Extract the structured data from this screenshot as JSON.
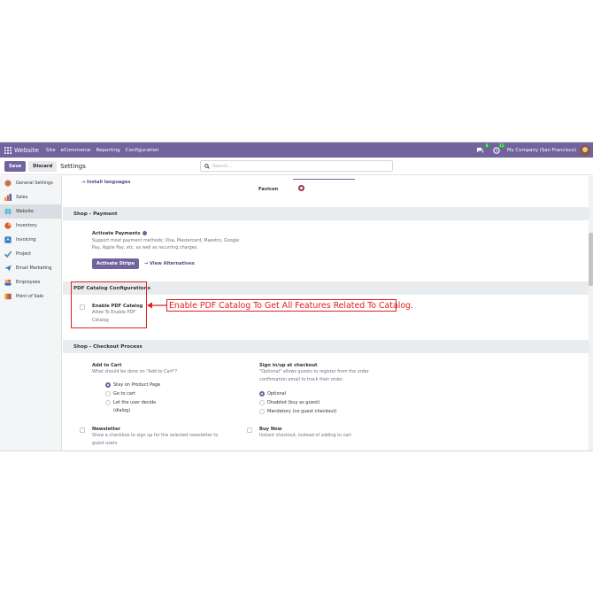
{
  "topbar": {
    "brand": "Website",
    "nav": [
      "Site",
      "eCommerce",
      "Reporting",
      "Configuration"
    ],
    "messages_count": "4",
    "activities_count": "11",
    "company": "My Company (San Francisco)",
    "accent": "#71639e"
  },
  "control": {
    "save_label": "Save",
    "discard_label": "Discard",
    "title": "Settings",
    "search_placeholder": "Search..."
  },
  "sidebar": {
    "items": [
      {
        "label": "General Settings",
        "icon": "general-settings-icon"
      },
      {
        "label": "Sales",
        "icon": "sales-icon"
      },
      {
        "label": "Website",
        "icon": "website-icon",
        "active": true
      },
      {
        "label": "Inventory",
        "icon": "inventory-icon"
      },
      {
        "label": "Invoicing",
        "icon": "invoicing-icon"
      },
      {
        "label": "Project",
        "icon": "project-icon"
      },
      {
        "label": "Email Marketing",
        "icon": "email-marketing-icon"
      },
      {
        "label": "Employees",
        "icon": "employees-icon"
      },
      {
        "label": "Point of Sale",
        "icon": "point-of-sale-icon"
      }
    ]
  },
  "main": {
    "install_languages": "Install languages",
    "favicon_label": "Favicon",
    "shop_payment": {
      "header": "Shop - Payment",
      "title": "Activate Payments",
      "desc": "Support most payment methods; Visa, Mastercard, Maestro, Google Pay, Apple Pay, etc. as well as recurring charges.",
      "stripe_button": "Activate Stripe",
      "alternatives_link": "View Alternatives"
    },
    "pdf_catalog": {
      "header": "PDF Catalog Configurations",
      "title": "Enable PDF Catalog",
      "desc_line1": "Allow To Enable PDF",
      "desc_line2": "Catalog",
      "callout": "Enable PDF Catalog To Get All Features Related To Catalog."
    },
    "checkout": {
      "header": "Shop - Checkout Process",
      "add_to_cart_title": "Add to Cart",
      "add_to_cart_desc": "What should be done on \"Add to Cart\"?",
      "add_to_cart_options": [
        "Stay on Product Page",
        "Go to cart",
        "Let the user decide",
        "(dialog)"
      ],
      "signin_title": "Sign in/up at checkout",
      "signin_desc_line1": "\"Optional\" allows guests to register from the order",
      "signin_desc_line2": "confirmation email to track their order.",
      "signin_options": [
        "Optional",
        "Disabled (buy as guest)",
        "Mandatory (no guest checkout)"
      ],
      "newsletter_title": "Newsletter",
      "newsletter_desc_line1": "Show a checkbox to sign up for the selected newsletter to",
      "newsletter_desc_line2": "guest users",
      "buynow_title": "Buy Now",
      "buynow_desc": "Instant checkout, instead of adding to cart"
    }
  }
}
